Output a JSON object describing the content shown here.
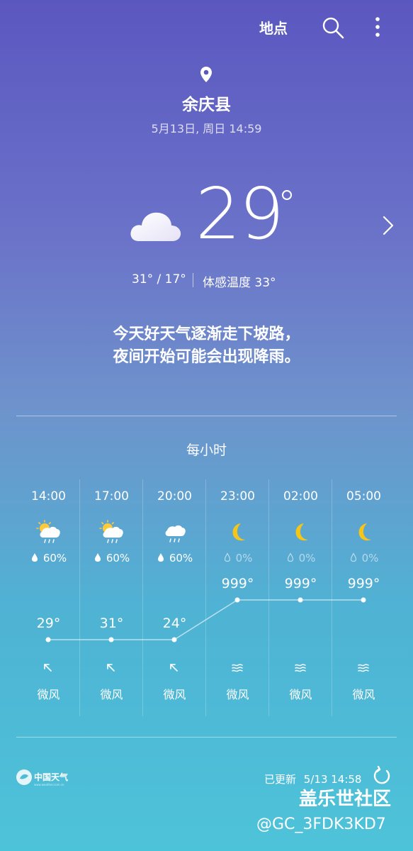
{
  "topbar": {
    "location_label": "地点",
    "search_icon": "search-icon",
    "more_icon": "more-vert-icon"
  },
  "location": {
    "city": "余庆县",
    "datetime": "5月13日, 周日 14:59"
  },
  "current": {
    "condition_icon": "cloud-icon",
    "temp": "29",
    "hi_lo": "31° / 17°",
    "feels_like": "体感温度 33°"
  },
  "summary": {
    "line1": "今天好天气逐渐走下坡路，",
    "line2": "夜间开始可能会出现降雨。"
  },
  "hourly": {
    "title": "每小时",
    "items": [
      {
        "time": "14:00",
        "icon": "sun-rain-cloud-icon",
        "precip": "60%",
        "temp": "29°",
        "temp_value": 29,
        "wind": "微风",
        "wind_icon": "arrow-up-left-icon"
      },
      {
        "time": "17:00",
        "icon": "sun-rain-cloud-icon",
        "precip": "60%",
        "temp": "31°",
        "temp_value": 31,
        "wind": "微风",
        "wind_icon": "arrow-up-left-icon"
      },
      {
        "time": "20:00",
        "icon": "rain-cloud-icon",
        "precip": "60%",
        "temp": "24°",
        "temp_value": 24,
        "wind": "微风",
        "wind_icon": "arrow-up-left-icon"
      },
      {
        "time": "23:00",
        "icon": "moon-icon",
        "precip": "0%",
        "temp": "999°",
        "temp_value": 999,
        "wind": "微风",
        "wind_icon": "wind-waves-icon"
      },
      {
        "time": "02:00",
        "icon": "moon-icon",
        "precip": "0%",
        "temp": "999°",
        "temp_value": 999,
        "wind": "微风",
        "wind_icon": "wind-waves-icon"
      },
      {
        "time": "05:00",
        "icon": "moon-icon",
        "precip": "0%",
        "temp": "999°",
        "temp_value": 999,
        "wind": "微风",
        "wind_icon": "wind-waves-icon"
      }
    ]
  },
  "footer": {
    "provider_logo": "中国天气",
    "updated_label": "已更新",
    "updated_time": "5/13  14:58",
    "refresh_icon": "refresh-icon"
  },
  "watermark": {
    "brand": "盖乐世社区",
    "handle": "@GC_3FDK3KD7"
  },
  "colors": {
    "moon": "#f5c518",
    "sun": "#ffc93c"
  }
}
